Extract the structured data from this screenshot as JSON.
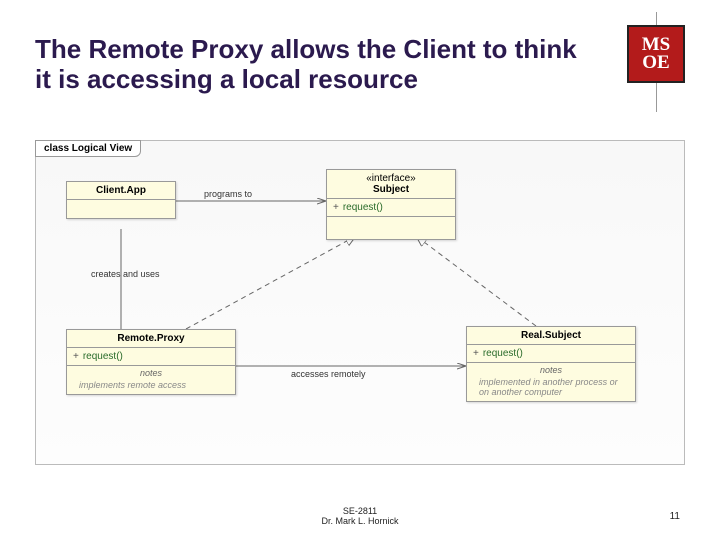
{
  "slide": {
    "title": "The Remote Proxy allows the Client to think it is accessing a local resource",
    "footer_course": "SE-2811",
    "footer_author": "Dr. Mark L. Hornick",
    "page_number": "11"
  },
  "logo": {
    "line1": "MS",
    "line2": "OE"
  },
  "diagram": {
    "label": "class Logical View",
    "boxes": {
      "client": {
        "title": "Client.App"
      },
      "subject": {
        "stereotype": "«interface»",
        "title": "Subject",
        "op_vis": "+",
        "op": "request()"
      },
      "proxy": {
        "title": "Remote.Proxy",
        "op_vis": "+",
        "op": "request()",
        "notes_header": "notes",
        "notes": "implements remote access"
      },
      "real": {
        "title": "Real.Subject",
        "op_vis": "+",
        "op": "request()",
        "notes_header": "notes",
        "notes": "implemented in another process or on another computer"
      }
    },
    "edges": {
      "programs_to": "programs to",
      "creates_uses": "creates and uses",
      "accesses_remotely": "accesses remotely"
    }
  },
  "chart_data": {
    "type": "uml-class-diagram",
    "title": "class Logical View",
    "classes": [
      {
        "name": "Client.App",
        "stereotype": null,
        "operations": [],
        "notes": null
      },
      {
        "name": "Subject",
        "stereotype": "interface",
        "operations": [
          "+ request()"
        ],
        "notes": null
      },
      {
        "name": "Remote.Proxy",
        "stereotype": null,
        "operations": [
          "+ request()"
        ],
        "notes": "implements remote access"
      },
      {
        "name": "Real.Subject",
        "stereotype": null,
        "operations": [
          "+ request()"
        ],
        "notes": "implemented in another process or on another computer"
      }
    ],
    "relationships": [
      {
        "from": "Client.App",
        "to": "Subject",
        "type": "association",
        "label": "programs to"
      },
      {
        "from": "Client.App",
        "to": "Remote.Proxy",
        "type": "association",
        "label": "creates and uses"
      },
      {
        "from": "Remote.Proxy",
        "to": "Subject",
        "type": "realization",
        "label": null
      },
      {
        "from": "Real.Subject",
        "to": "Subject",
        "type": "realization",
        "label": null
      },
      {
        "from": "Remote.Proxy",
        "to": "Real.Subject",
        "type": "association",
        "label": "accesses remotely"
      }
    ]
  }
}
